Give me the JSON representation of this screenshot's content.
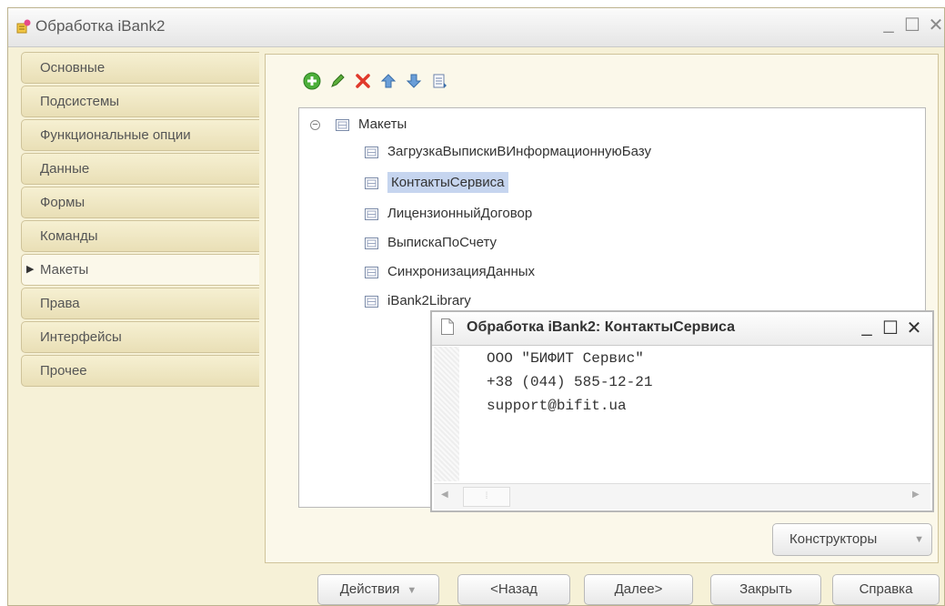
{
  "window": {
    "title": "Обработка iBank2"
  },
  "tabs": [
    {
      "label": "Основные"
    },
    {
      "label": "Подсистемы"
    },
    {
      "label": "Функциональные опции"
    },
    {
      "label": "Данные"
    },
    {
      "label": "Формы"
    },
    {
      "label": "Команды"
    },
    {
      "label": "Макеты",
      "active": true
    },
    {
      "label": "Права"
    },
    {
      "label": "Интерфейсы"
    },
    {
      "label": "Прочее"
    }
  ],
  "toolbar": {
    "icons": [
      "add-icon",
      "edit-icon",
      "delete-icon",
      "move-up-icon",
      "move-down-icon",
      "sort-icon"
    ]
  },
  "tree": {
    "root": "Макеты",
    "items": [
      {
        "label": "ЗагрузкаВыпискиВИнформационнуюБазу"
      },
      {
        "label": "КонтактыСервиса",
        "selected": true
      },
      {
        "label": "ЛицензионныйДоговор"
      },
      {
        "label": "ВыпискаПоСчету"
      },
      {
        "label": "СинхронизацияДанных"
      },
      {
        "label": "iBank2Library"
      }
    ]
  },
  "subwindow": {
    "title": "Обработка iBank2: КонтактыСервиса",
    "lines": [
      "ООО \"БИФИТ Сервис\"",
      "+38 (044) 585-12-21",
      "support@bifit.ua"
    ]
  },
  "constructors_button": "Конструкторы",
  "footer": {
    "actions": "Действия",
    "back": "<Назад",
    "next": "Далее>",
    "close": "Закрыть",
    "help": "Справка"
  }
}
